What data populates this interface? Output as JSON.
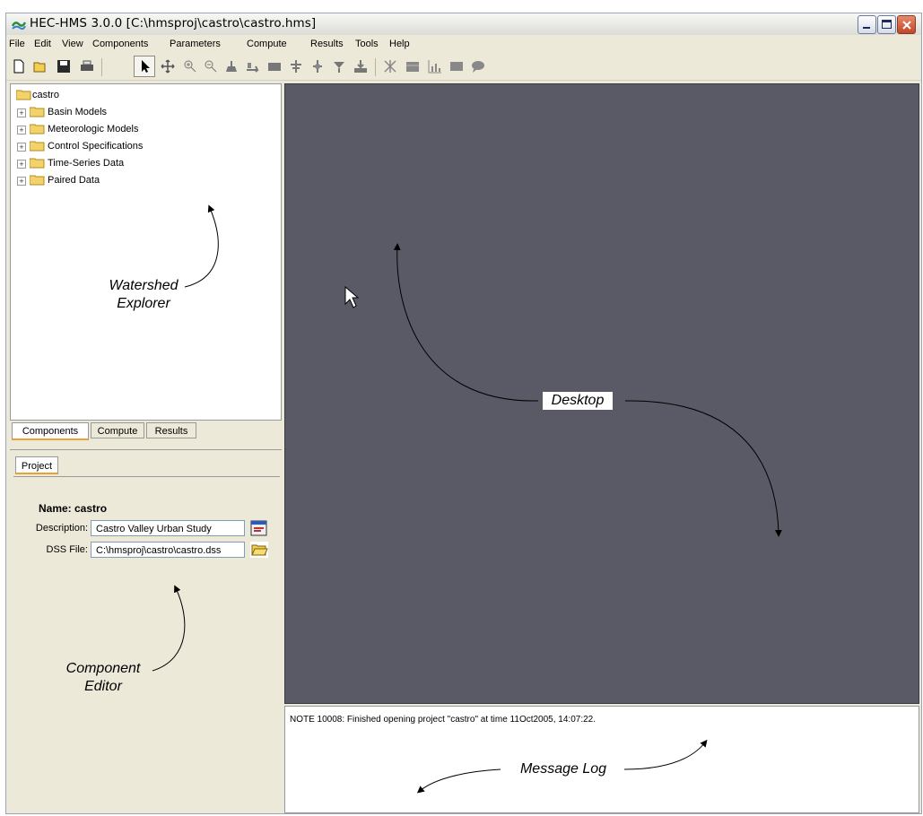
{
  "window": {
    "title": "HEC-HMS 3.0.0 [C:\\hmsproj\\castro\\castro.hms]"
  },
  "menu": [
    "File",
    "Edit",
    "View",
    "Components",
    "Parameters",
    "Compute",
    "Results",
    "Tools",
    "Help"
  ],
  "toolbar_icons": [
    "new-icon",
    "open-icon",
    "save-icon",
    "print-icon",
    "arrow-select-icon",
    "pan-icon",
    "zoom-in-icon",
    "zoom-out-icon",
    "subbasin-icon",
    "reach-icon",
    "reservoir-icon",
    "junction-icon",
    "diversion-icon",
    "source-icon",
    "sink-icon",
    "compute-icon",
    "table-icon",
    "graph-icon",
    "summary-icon",
    "message-icon"
  ],
  "explorer": {
    "root": "castro",
    "folders": [
      "Basin Models",
      "Meteorologic Models",
      "Control Specifications",
      "Time-Series Data",
      "Paired Data"
    ]
  },
  "explorer_tabs": [
    "Components",
    "Compute",
    "Results"
  ],
  "editor": {
    "tab": "Project",
    "name_label": "Name:",
    "name_value": "castro",
    "description_label": "Description:",
    "description_value": "Castro Valley Urban Study",
    "dss_label": "DSS File:",
    "dss_value": "C:\\hmsproj\\castro\\castro.dss"
  },
  "message_log": {
    "text": "NOTE 10008:  Finished opening project \"castro\" at time 11Oct2005, 14:07:22."
  },
  "annotations": {
    "watershed_1": "Watershed",
    "watershed_2": "Explorer",
    "desktop": "Desktop",
    "component_1": "Component",
    "component_2": "Editor",
    "message_log": "Message Log"
  },
  "colors": {
    "desktop_bg": "#5a5a67",
    "window_bg": "#ece9d8",
    "close_button": "#c0452a",
    "active_tab_accent": "#f0a030"
  }
}
